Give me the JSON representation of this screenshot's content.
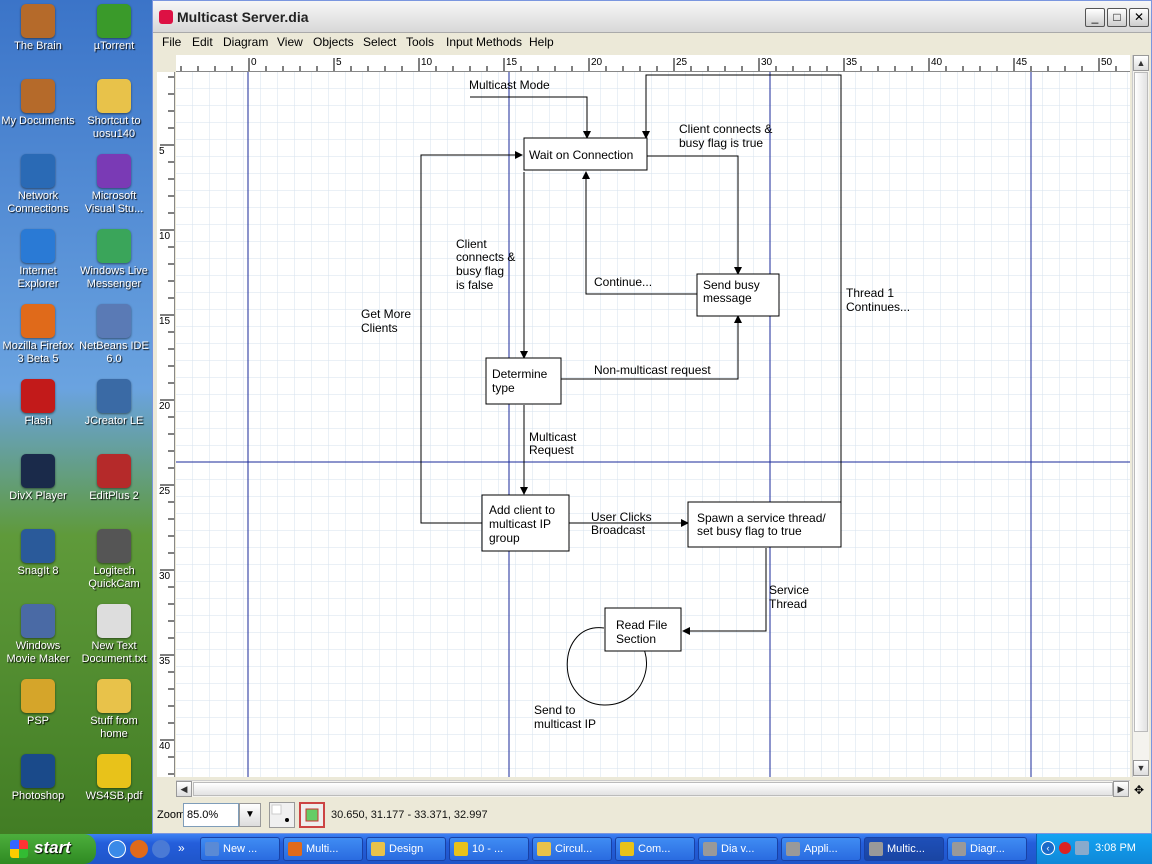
{
  "desktop": {
    "icons": [
      {
        "label": "The Brain",
        "color": "#b56a2a"
      },
      {
        "label": "µTorrent",
        "color": "#3a9a2a"
      },
      {
        "label": "My Documents",
        "color": "#b56a2a"
      },
      {
        "label": "Shortcut to uosu140",
        "color": "#e8c24a"
      },
      {
        "label": "Network Connections",
        "color": "#2a6ab5"
      },
      {
        "label": "Microsoft Visual Stu...",
        "color": "#7a3ab5"
      },
      {
        "label": "Internet Explorer",
        "color": "#2a7ad5"
      },
      {
        "label": "Windows Live Messenger",
        "color": "#3aa55a"
      },
      {
        "label": "Mozilla Firefox 3 Beta 5",
        "color": "#e06a1a"
      },
      {
        "label": "NetBeans IDE 6.0",
        "color": "#5a7ab5"
      },
      {
        "label": "Flash",
        "color": "#c21a1a"
      },
      {
        "label": "JCreator LE",
        "color": "#3a6aa5"
      },
      {
        "label": "DivX Player",
        "color": "#1a2a4a"
      },
      {
        "label": "EditPlus 2",
        "color": "#b52a2a"
      },
      {
        "label": "SnagIt 8",
        "color": "#2a5a9a"
      },
      {
        "label": "Logitech QuickCam",
        "color": "#555555"
      },
      {
        "label": "Windows Movie Maker",
        "color": "#4a6aa5"
      },
      {
        "label": "New Text Document.txt",
        "color": "#dddddd"
      },
      {
        "label": "PSP",
        "color": "#d5a52a"
      },
      {
        "label": "Stuff from home",
        "color": "#e8c24a"
      },
      {
        "label": "Photoshop",
        "color": "#1a4a8a"
      },
      {
        "label": "WS4SB.pdf",
        "color": "#e8c21a"
      }
    ]
  },
  "window": {
    "title": "Multicast Server.dia",
    "menus": [
      "File",
      "Edit",
      "Diagram",
      "View",
      "Objects",
      "Select",
      "Tools",
      "Input Methods",
      "Help"
    ]
  },
  "rulers": {
    "horizontal_ticks": [
      "0",
      "5",
      "10",
      "15",
      "20",
      "25",
      "30",
      "35",
      "40",
      "45",
      "50"
    ],
    "vertical_ticks": [
      "5",
      "10",
      "15",
      "20",
      "25",
      "30",
      "35",
      "40"
    ]
  },
  "diagram": {
    "boxes": {
      "wait": "Wait on Connection",
      "busy": [
        "Send busy",
        "message"
      ],
      "determine": [
        "Determine",
        "type"
      ],
      "add": [
        "Add client to",
        "multicast IP",
        "group"
      ],
      "spawn": [
        "Spawn a service thread/",
        "set busy flag to true"
      ],
      "read": [
        "Read File",
        "Section"
      ]
    },
    "labels": {
      "multicast_mode": "Multicast Mode",
      "client_true": [
        "Client connects &",
        "busy flag is true"
      ],
      "client_false": [
        "Client",
        "connects &",
        "busy flag",
        "is false"
      ],
      "continue": "Continue...",
      "get_more": [
        "Get More",
        "Clients"
      ],
      "thread1": [
        "Thread 1",
        "Continues..."
      ],
      "non_multicast": "Non-multicast request",
      "multicast_request": [
        "Multicast",
        "Request"
      ],
      "user_clicks": [
        "User Clicks",
        "Broadcast"
      ],
      "service_thread": [
        "Service",
        "Thread"
      ],
      "send_to": [
        "Send to",
        "multicast IP"
      ]
    }
  },
  "status": {
    "zoom_label": "Zoom",
    "zoom_value": "85.0%",
    "coordinates": "30.650, 31.177 - 33.371, 32.997"
  },
  "taskbar": {
    "start_label": "start",
    "tasks": [
      {
        "label": "New ...",
        "color": "#5a8ad5",
        "active": false
      },
      {
        "label": "Multi...",
        "color": "#e06a1a",
        "active": false
      },
      {
        "label": "Design",
        "color": "#e8c24a",
        "active": false
      },
      {
        "label": "10 - ...",
        "color": "#e8c21a",
        "active": false
      },
      {
        "label": "Circul...",
        "color": "#e8c24a",
        "active": false
      },
      {
        "label": "Com...",
        "color": "#e8c21a",
        "active": false
      },
      {
        "label": "Dia v...",
        "color": "#999999",
        "active": false
      },
      {
        "label": "Appli...",
        "color": "#999999",
        "active": false
      },
      {
        "label": "Multic...",
        "color": "#999999",
        "active": true
      },
      {
        "label": "Diagr...",
        "color": "#999999",
        "active": false
      }
    ],
    "clock": "3:08 PM"
  }
}
